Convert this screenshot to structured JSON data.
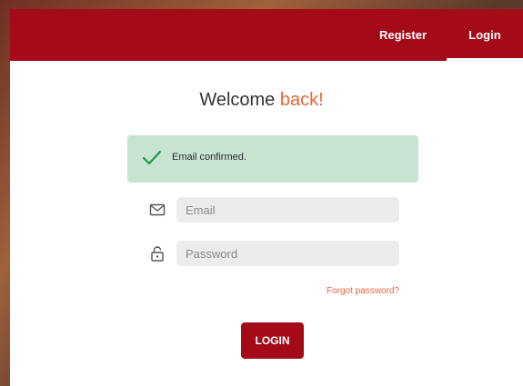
{
  "nav": {
    "register_label": "Register",
    "login_label": "Login"
  },
  "title": {
    "prefix": "Welcome ",
    "accent": "back!"
  },
  "alert": {
    "message": "Email confirmed.",
    "icon": "checkmark-icon"
  },
  "form": {
    "email_placeholder": "Email",
    "email_value": "",
    "email_icon": "envelope-icon",
    "password_placeholder": "Password",
    "password_value": "",
    "password_icon": "lock-icon",
    "forgot_label": "Forgot password?",
    "submit_label": "LOGIN"
  },
  "colors": {
    "brand": "#a50a18",
    "accent": "#e8643c",
    "success_bg": "#c7e4d3",
    "success_check": "#1e9a4a",
    "input_bg": "#ececec"
  }
}
